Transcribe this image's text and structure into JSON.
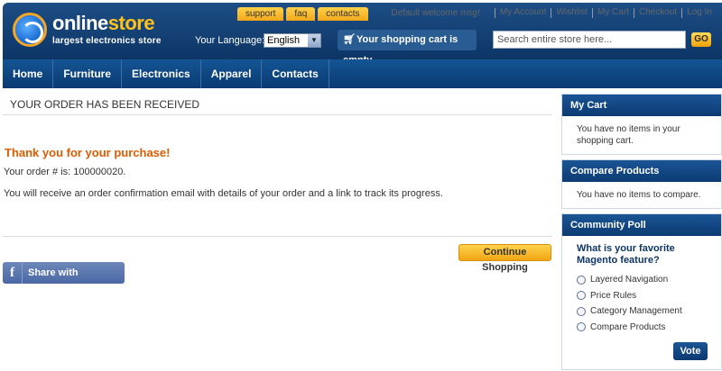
{
  "header": {
    "logo_brand_a": "online",
    "logo_brand_b": "store",
    "logo_tagline": "largest electronics store",
    "tabs": [
      "support",
      "faq",
      "contacts"
    ],
    "welcome": "Default welcome msg!",
    "top_links": [
      "My Account",
      "Wishlist",
      "My Cart",
      "Checkout",
      "Log In"
    ],
    "language_label": "Your Language:",
    "language_value": "English",
    "cart_text": "Your shopping cart is empty",
    "search_placeholder": "Search entire store here...",
    "search_go": "GO"
  },
  "nav": {
    "items": [
      "Home",
      "Furniture",
      "Electronics",
      "Apparel",
      "Contacts"
    ]
  },
  "main": {
    "title": "YOUR ORDER HAS BEEN RECEIVED",
    "thanks": "Thank you for your purchase!",
    "order_line": "Your order # is: 100000020.",
    "confirm_line": "You will receive an order confirmation email with details of your order and a link to track its progress.",
    "continue_label": "Continue Shopping",
    "facebook_label": "Share with Facebook",
    "facebook_glyph": "f"
  },
  "sidebar": {
    "cart": {
      "title": "My Cart",
      "text": "You have no items in your shopping cart."
    },
    "compare": {
      "title": "Compare Products",
      "text": "You have no items to compare."
    },
    "poll": {
      "title": "Community Poll",
      "question": "What is your favorite Magento feature?",
      "options": [
        "Layered Navigation",
        "Price Rules",
        "Category Management",
        "Compare Products"
      ],
      "vote_label": "Vote"
    }
  },
  "colors": {
    "brand_blue": "#0d3566",
    "accent_orange": "#f0a513",
    "thanks_orange": "#e05a00"
  }
}
